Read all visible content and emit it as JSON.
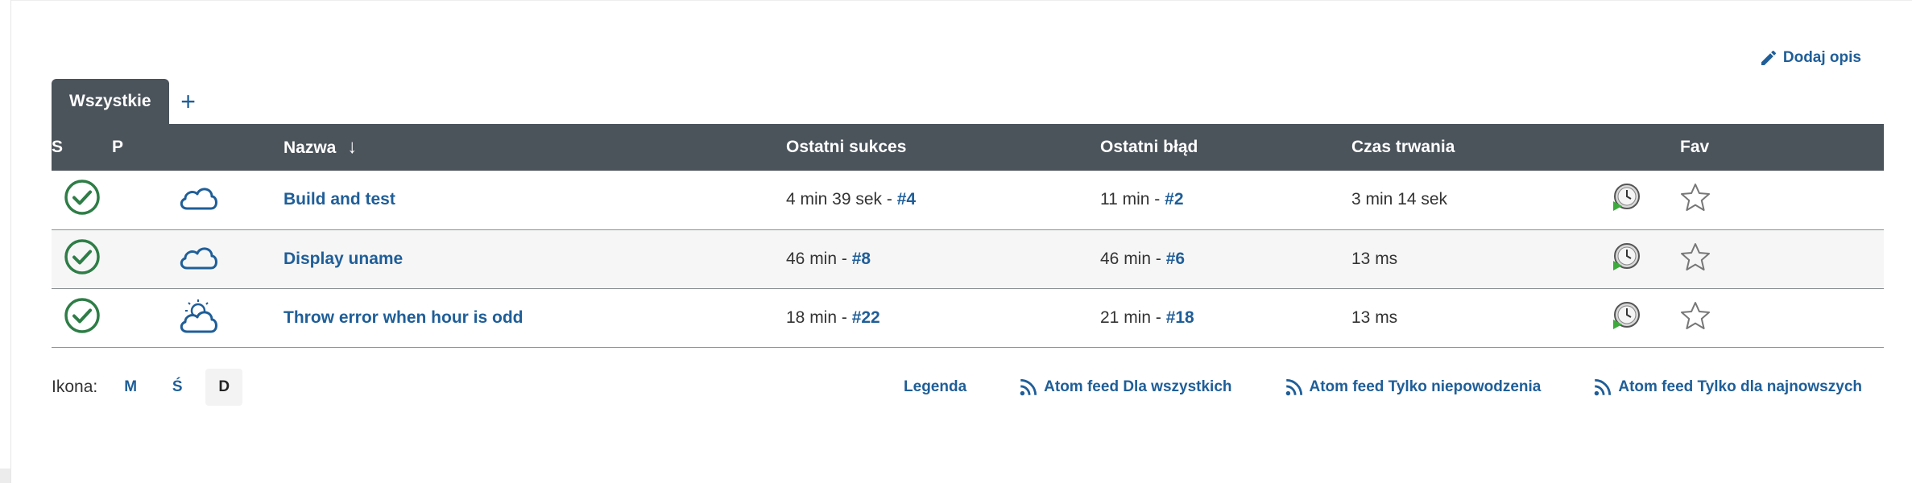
{
  "header": {
    "add_description_label": "Dodaj opis"
  },
  "tabs": [
    {
      "label": "Wszystkie",
      "active": true
    }
  ],
  "tab_add_symbol": "+",
  "table": {
    "columns": {
      "status": "S",
      "weather": "P",
      "name": "Nazwa",
      "name_sort_indicator": "↓",
      "last_success": "Ostatni sukces",
      "last_failure": "Ostatni błąd",
      "duration": "Czas trwania",
      "fav": "Fav"
    },
    "rows": [
      {
        "status_icon": "success-check-icon",
        "weather_icon": "cloudy-weather-icon",
        "name": "Build and test",
        "last_success_time": "4 min 39 sek - ",
        "last_success_build": "#4",
        "last_failure_time": "11 min - ",
        "last_failure_build": "#2",
        "duration": "3 min 14 sek"
      },
      {
        "status_icon": "success-check-icon",
        "weather_icon": "cloudy-weather-icon",
        "name": "Display uname",
        "last_success_time": "46 min - ",
        "last_success_build": "#8",
        "last_failure_time": "46 min - ",
        "last_failure_build": "#6",
        "duration": "13 ms"
      },
      {
        "status_icon": "success-check-icon",
        "weather_icon": "stormy-weather-icon",
        "name": "Throw error when hour is odd",
        "last_success_time": "18 min - ",
        "last_success_build": "#22",
        "last_failure_time": "21 min - ",
        "last_failure_build": "#18",
        "duration": "13 ms"
      }
    ]
  },
  "footer": {
    "icon_label": "Ikona:",
    "sizes": [
      "M",
      "Ś",
      "D"
    ],
    "active_size": "D",
    "links": [
      "Legenda",
      "Atom feed Dla wszystkich",
      "Atom feed Tylko niepowodzenia",
      "Atom feed Tylko dla najnowszych"
    ]
  },
  "colors": {
    "accent": "#1f5e98",
    "header_bg": "#4b535b",
    "success": "#2e7d46"
  }
}
